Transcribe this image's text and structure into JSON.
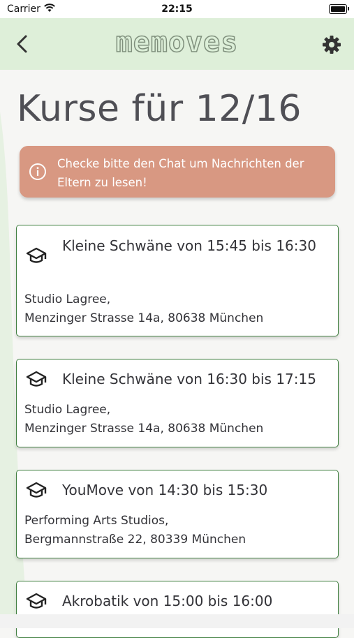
{
  "status_bar": {
    "carrier": "Carrier",
    "time": "22:15"
  },
  "app_bar": {
    "logo": "memoves",
    "back_icon": "chevron-left-icon",
    "settings_icon": "gear-icon"
  },
  "page": {
    "title": "Kurse für 12/16"
  },
  "alert": {
    "text": "Checke bitte den Chat um Nachrichten der Eltern zu lesen!",
    "icon": "info-icon",
    "color": "#d89882"
  },
  "courses": [
    {
      "title": "Kleine Schwäne von 15:45 bis 16:30",
      "venue": "Studio Lagree,",
      "address": "Menzinger Strasse 14a, 80638 München"
    },
    {
      "title": "Kleine Schwäne von 16:30 bis 17:15",
      "venue": "Studio Lagree,",
      "address": "Menzinger Strasse 14a, 80638 München"
    },
    {
      "title": "YouMove von 14:30 bis 15:30",
      "venue": "Performing Arts Studios,",
      "address": "Bergmannstraße 22, 80339 München"
    },
    {
      "title": "Akrobatik von 15:00 bis 16:00",
      "venue": "",
      "address": ""
    }
  ],
  "colors": {
    "accent_green": "#3f7f3f",
    "header_bg": "#deefd9",
    "alert_bg": "#d89882"
  }
}
